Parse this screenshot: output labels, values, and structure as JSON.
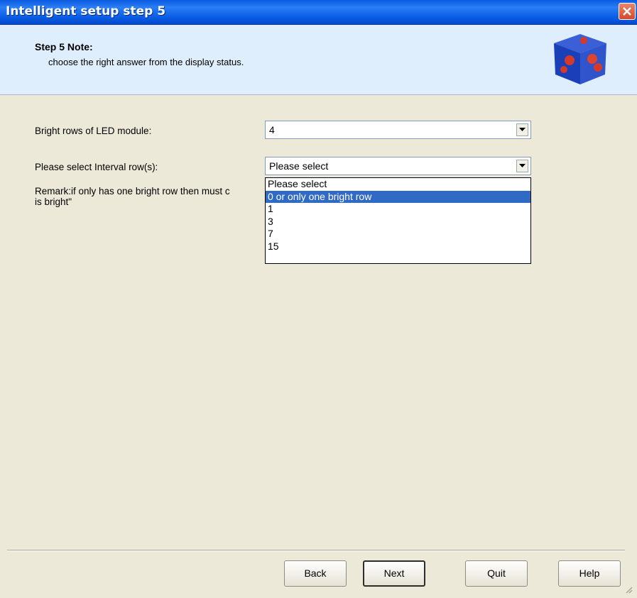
{
  "window": {
    "title": "Intelligent setup step 5"
  },
  "header": {
    "heading": "Step 5 Note:",
    "description": "choose the right answer from the display status."
  },
  "form": {
    "bright_rows": {
      "label": "Bright rows of LED module:",
      "value": "4"
    },
    "interval_rows": {
      "label": "Please select Interval row(s):",
      "value": "Please select"
    },
    "remark_line1": "Remark:if only has one bright row then must c",
    "remark_line2": "is bright\"",
    "options": [
      "Please select",
      "0 or only one bright row",
      "1",
      "3",
      "7",
      "15"
    ],
    "highlighted_option": "0 or only one bright row"
  },
  "buttons": {
    "back": "Back",
    "next": "Next",
    "quit": "Quit",
    "help": "Help"
  },
  "colors": {
    "titlebar": "#0a5ae0",
    "header_bg": "#dfeefd",
    "dialog_bg": "#ece9d8",
    "selection": "#316ac5"
  }
}
